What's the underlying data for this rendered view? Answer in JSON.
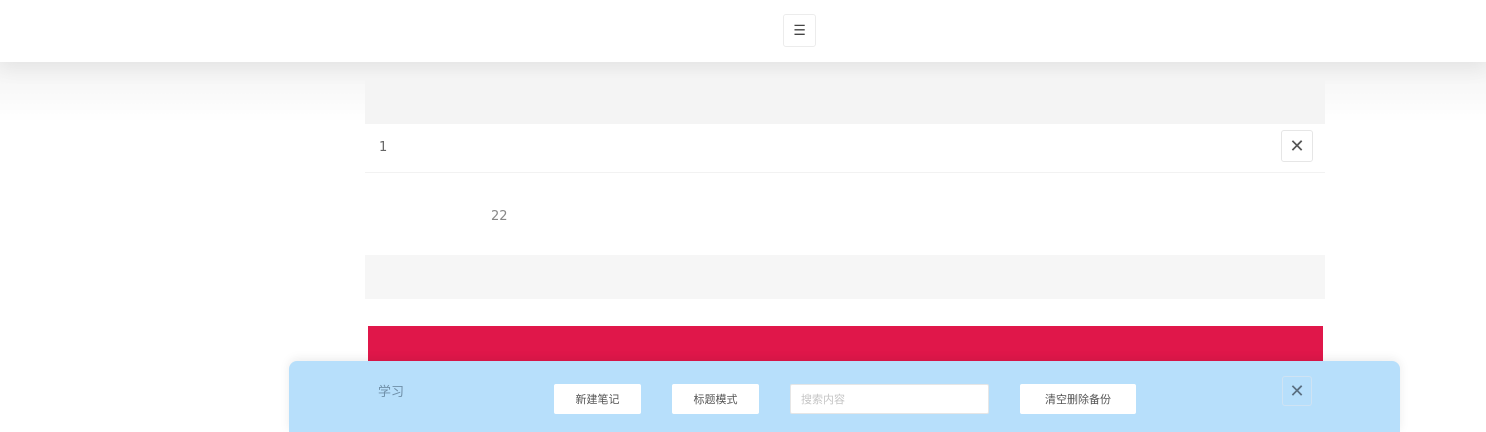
{
  "topbar": {
    "menu_icon": "list-icon",
    "menu_glyph": "☰"
  },
  "note": {
    "title": "1",
    "content": "22",
    "close_icon": "close-icon",
    "close_glyph": "✕"
  },
  "colors": {
    "accent_bar": "#e0174a",
    "toolbar_bg": "#b7dffb"
  },
  "toolbar": {
    "category": "学习",
    "new_note_label": "新建笔记",
    "title_mode_label": "标题模式",
    "search_placeholder": "搜索内容",
    "search_value": "",
    "clear_label": "清空删除备份",
    "close_icon": "close-icon",
    "close_glyph": "✕"
  }
}
